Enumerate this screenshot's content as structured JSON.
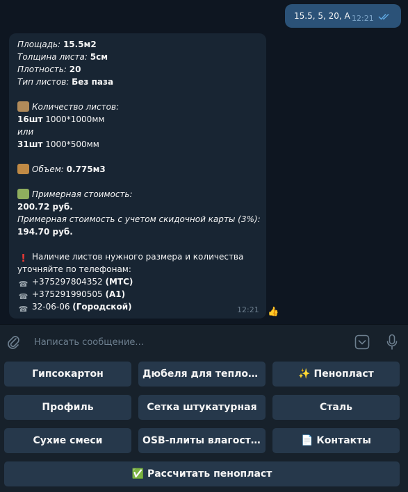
{
  "outgoing": {
    "text": "15.5, 5, 20, А",
    "time": "12:21"
  },
  "incoming": {
    "area_label": "Площадь:",
    "area_value": "15.5м2",
    "thickness_label": "Толщина листа:",
    "thickness_value": "5см",
    "density_label": "Плотность:",
    "density_value": "20",
    "type_label": "Тип листов:",
    "type_value": "Без паза",
    "qty_label": "Количество листов:",
    "qty1_count": "16шт",
    "qty1_size": "1000*1000мм",
    "or": "или",
    "qty2_count": "31шт",
    "qty2_size": "1000*500мм",
    "volume_label": "Объем:",
    "volume_value": "0.775м3",
    "cost_label": "Примерная стоимость:",
    "cost_value": "200.72 руб.",
    "discount_label": "Примерная стоимость с учетом скидочной карты (3%):",
    "discount_value": "194.70 руб.",
    "notice_line1": "Наличие листов нужного размера и количества",
    "notice_line2": "уточняйте по телефонам:",
    "phone1": "+375297804352",
    "phone1_op": "(МТС)",
    "phone2": "+375291990505",
    "phone2_op": "(А1)",
    "phone3": "32-06-06",
    "phone3_op": "(Городской)",
    "time": "12:21",
    "reaction": "👍"
  },
  "composer": {
    "placeholder": "Написать сообщение..."
  },
  "keyboard": {
    "b1": "Гипсокартон",
    "b2": "Дюбеля для теплоизоляции",
    "b3": "Пенопласт",
    "b3_icon": "✨",
    "b4": "Профиль",
    "b5": "Сетка штукатурная",
    "b6": "Сталь",
    "b7": "Сухие смеси",
    "b8": "OSB-плиты влагостойкие",
    "b9": "Контакты",
    "b9_icon": "📄",
    "b10": "Рассчитать пенопласт",
    "b10_icon": "✅"
  },
  "colors": {
    "bg": "#0e1621",
    "bubble_in": "#182533",
    "bubble_out": "#2b5278",
    "button": "#26384b"
  }
}
